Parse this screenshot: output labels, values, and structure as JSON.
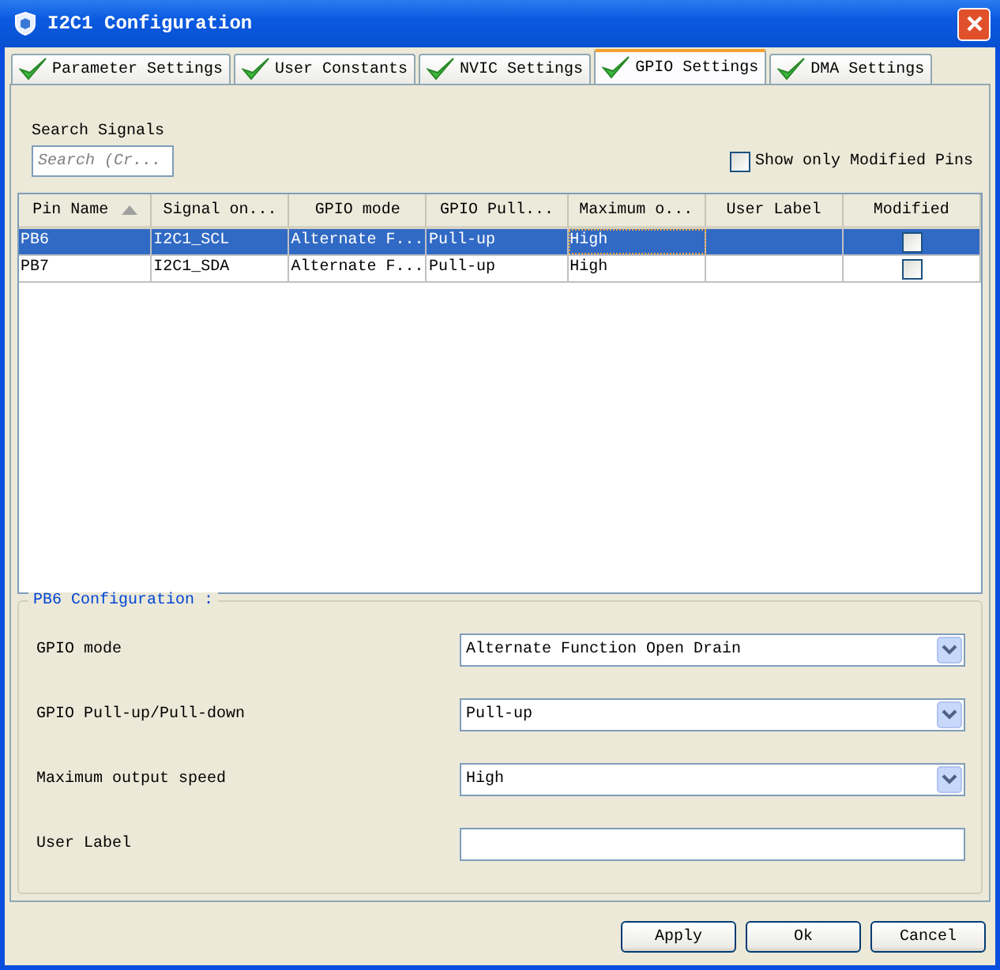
{
  "window": {
    "title": "I2C1 Configuration"
  },
  "tabs": [
    {
      "label": "Parameter Settings",
      "selected": false
    },
    {
      "label": "User Constants",
      "selected": false
    },
    {
      "label": "NVIC Settings",
      "selected": false
    },
    {
      "label": "GPIO Settings",
      "selected": true
    },
    {
      "label": "DMA Settings",
      "selected": false
    }
  ],
  "search": {
    "label": "Search Signals",
    "placeholder": "Search (Cr..."
  },
  "show_only_modified": {
    "label": "Show only Modified Pins",
    "checked": false
  },
  "table": {
    "columns": [
      {
        "label": "Pin Name",
        "sorted": true
      },
      {
        "label": "Signal on...",
        "sorted": false
      },
      {
        "label": "GPIO mode",
        "sorted": false
      },
      {
        "label": "GPIO Pull...",
        "sorted": false
      },
      {
        "label": "Maximum o...",
        "sorted": false
      },
      {
        "label": "User Label",
        "sorted": false
      },
      {
        "label": "Modified",
        "sorted": false
      }
    ],
    "rows": [
      {
        "cells": [
          "PB6",
          "I2C1_SCL",
          "Alternate F...",
          "Pull-up",
          "High",
          ""
        ],
        "modified": false,
        "selected": true
      },
      {
        "cells": [
          "PB7",
          "I2C1_SDA",
          "Alternate F...",
          "Pull-up",
          "High",
          ""
        ],
        "modified": false,
        "selected": false
      }
    ]
  },
  "configuration": {
    "title": "PB6 Configuration :",
    "fields": [
      {
        "kind": "dropdown",
        "label": "GPIO mode",
        "value": "Alternate Function Open Drain"
      },
      {
        "kind": "dropdown",
        "label": "GPIO Pull-up/Pull-down",
        "value": "Pull-up"
      },
      {
        "kind": "dropdown",
        "label": "Maximum output speed",
        "value": "High"
      },
      {
        "kind": "text",
        "label": "User Label"
      }
    ]
  },
  "buttons": [
    "Apply",
    "Ok",
    "Cancel"
  ]
}
